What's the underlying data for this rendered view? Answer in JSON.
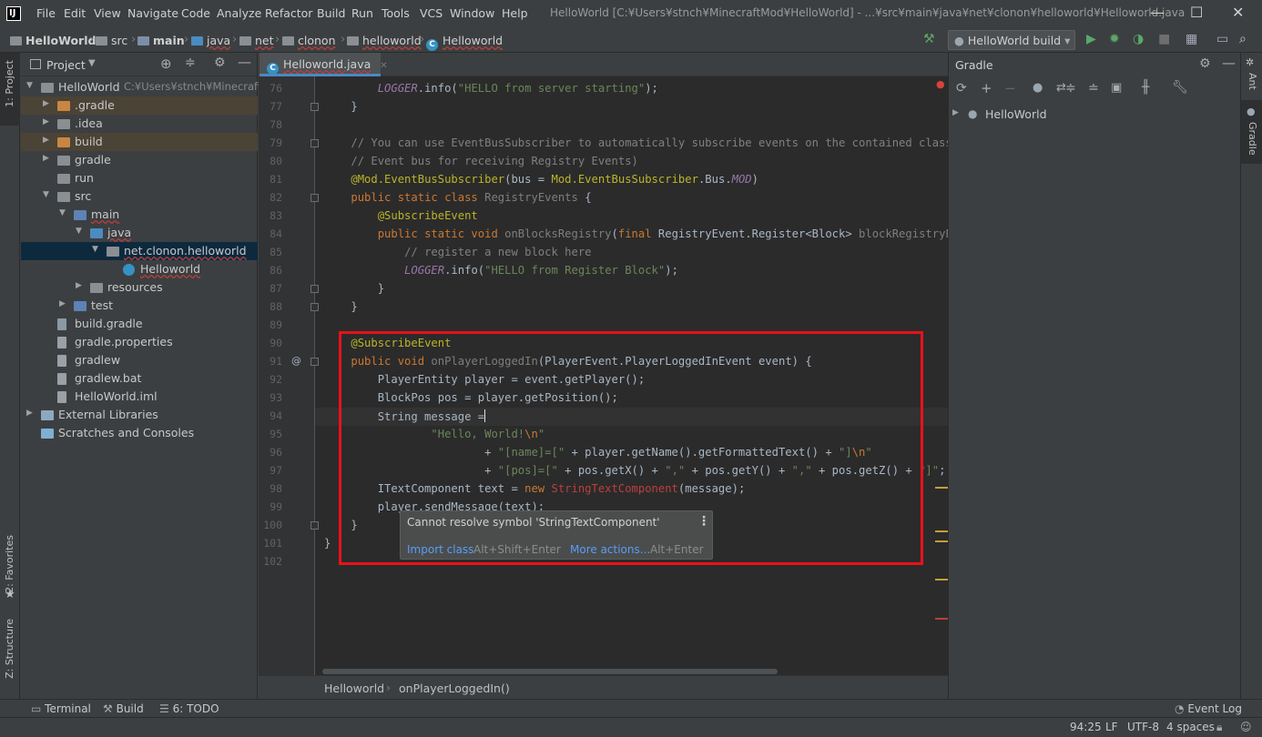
{
  "menu": [
    "File",
    "Edit",
    "View",
    "Navigate",
    "Code",
    "Analyze",
    "Refactor",
    "Build",
    "Run",
    "Tools",
    "VCS",
    "Window",
    "Help"
  ],
  "window_title": "HelloWorld [C:¥Users¥stnch¥MinecraftMod¥HelloWorld] - ...¥src¥main¥java¥net¥clonon¥helloworld¥Helloworld.java",
  "window_controls": {
    "minimize": "—",
    "maximize": "☐",
    "close": "✕"
  },
  "breadcrumbs": [
    "HelloWorld",
    "src",
    "main",
    "java",
    "net",
    "clonon",
    "helloworld",
    "Helloworld"
  ],
  "run_config": "HelloWorld build",
  "project_panel": {
    "title": "Project",
    "tree": [
      {
        "label": "HelloWorld",
        "hint": "C:¥Users¥stnch¥MinecraftMo",
        "depth": 0,
        "arrow": "▼",
        "icon": "folder"
      },
      {
        "label": ".gradle",
        "depth": 1,
        "arrow": "▶",
        "icon": "folder-orange",
        "style": "hl-build"
      },
      {
        "label": ".idea",
        "depth": 1,
        "arrow": "▶",
        "icon": "folder"
      },
      {
        "label": "build",
        "depth": 1,
        "arrow": "▶",
        "icon": "folder-orange",
        "style": "hl-build"
      },
      {
        "label": "gradle",
        "depth": 1,
        "arrow": "▶",
        "icon": "folder"
      },
      {
        "label": "run",
        "depth": 1,
        "arrow": "",
        "icon": "folder"
      },
      {
        "label": "src",
        "depth": 1,
        "arrow": "▼",
        "icon": "folder"
      },
      {
        "label": "main",
        "depth": 2,
        "arrow": "▼",
        "icon": "module"
      },
      {
        "label": "java",
        "depth": 3,
        "arrow": "▼",
        "icon": "folder-blue"
      },
      {
        "label": "net.clonon.helloworld",
        "depth": 4,
        "arrow": "▼",
        "icon": "package",
        "style": "sel"
      },
      {
        "label": "Helloworld",
        "depth": 5,
        "arrow": "",
        "icon": "class"
      },
      {
        "label": "resources",
        "depth": 3,
        "arrow": "▶",
        "icon": "folder-res"
      },
      {
        "label": "test",
        "depth": 2,
        "arrow": "▶",
        "icon": "module"
      },
      {
        "label": "build.gradle",
        "depth": 1,
        "arrow": "",
        "icon": "gradle"
      },
      {
        "label": "gradle.properties",
        "depth": 1,
        "arrow": "",
        "icon": "props"
      },
      {
        "label": "gradlew",
        "depth": 1,
        "arrow": "",
        "icon": "file"
      },
      {
        "label": "gradlew.bat",
        "depth": 1,
        "arrow": "",
        "icon": "file"
      },
      {
        "label": "HelloWorld.iml",
        "depth": 1,
        "arrow": "",
        "icon": "file"
      },
      {
        "label": "External Libraries",
        "depth": 0,
        "arrow": "▶",
        "icon": "libs"
      },
      {
        "label": "Scratches and Consoles",
        "depth": 0,
        "arrow": "",
        "icon": "scratch"
      }
    ]
  },
  "editor": {
    "tab": "Helloworld.java",
    "current_line": 94,
    "lines": [
      {
        "n": 76,
        "html": "        <span class=\"fld\">LOGGER</span>.info(<span class=\"str\">\"HELLO from server starting\"</span>);"
      },
      {
        "n": 77,
        "html": "    }"
      },
      {
        "n": 78,
        "html": ""
      },
      {
        "n": 79,
        "html": "    <span class=\"cmt\">// You can use EventBusSubscriber to automatically subscribe events on the contained class (thi</span>"
      },
      {
        "n": 80,
        "html": "    <span class=\"cmt\">// Event bus for receiving Registry Events)</span>"
      },
      {
        "n": 81,
        "html": "    <span class=\"ann\">@Mod.EventBusSubscriber</span>(bus = <span class=\"ann\">Mod.EventBusSubscriber</span>.Bus.<span class=\"fld\">MOD</span>)"
      },
      {
        "n": 82,
        "html": "    <span class=\"kw\">public static class</span> <span class=\"dim\">RegistryEvents</span> {"
      },
      {
        "n": 83,
        "html": "        <span class=\"ann\">@SubscribeEvent</span>"
      },
      {
        "n": 84,
        "html": "        <span class=\"kw\">public static void</span> <span class=\"dim\">onBlocksRegistry</span>(<span class=\"kw\">final</span> RegistryEvent.Register&lt;Block&gt; <span class=\"dim\">blockRegistryEvent</span>)"
      },
      {
        "n": 85,
        "html": "            <span class=\"cmt\">// register a new block here</span>"
      },
      {
        "n": 86,
        "html": "            <span class=\"fld\">LOGGER</span>.info(<span class=\"str\">\"HELLO from Register Block\"</span>);"
      },
      {
        "n": 87,
        "html": "        }"
      },
      {
        "n": 88,
        "html": "    }"
      },
      {
        "n": 89,
        "html": ""
      },
      {
        "n": 90,
        "html": "    <span class=\"ann\">@SubscribeEvent</span>"
      },
      {
        "n": 91,
        "html": "    <span class=\"kw\">public void</span> <span class=\"dim\">onPlayerLoggedIn</span>(PlayerEvent.PlayerLoggedInEvent event) {"
      },
      {
        "n": 92,
        "html": "        PlayerEntity player = event.getPlayer();"
      },
      {
        "n": 93,
        "html": "        BlockPos pos = player.getPosition();"
      },
      {
        "n": 94,
        "html": "        String message ="
      },
      {
        "n": 95,
        "html": "                <span class=\"str\">\"Hello, World!<span class=\"esc\">\\n</span>\"</span>"
      },
      {
        "n": 96,
        "html": "                        + <span class=\"str\">\"[name]=[\"</span> + player.getName().getFormattedText() + <span class=\"str\">\"]<span class=\"esc\">\\n</span>\"</span>"
      },
      {
        "n": 97,
        "html": "                        + <span class=\"str\">\"[pos]=[\"</span> + pos.getX() + <span class=\"str\">\",\"</span> + pos.getY() + <span class=\"str\">\",\"</span> + pos.getZ() + <span class=\"str\">\"]\"</span>;"
      },
      {
        "n": 98,
        "html": "        ITextComponent text = <span class=\"kw\">new</span> <span class=\"unres\">StringTextComponent</span>(message);"
      },
      {
        "n": 99,
        "html": "        player.sendMessage(text);"
      },
      {
        "n": 100,
        "html": "    }"
      },
      {
        "n": 101,
        "html": "}"
      },
      {
        "n": 102,
        "html": ""
      }
    ],
    "breadcrumb": [
      "Helloworld",
      "onPlayerLoggedIn()"
    ]
  },
  "tooltip": {
    "message": "Cannot resolve symbol 'StringTextComponent'",
    "action1": "Import class",
    "shortcut1": "Alt+Shift+Enter",
    "action2": "More actions...",
    "shortcut2": "Alt+Enter"
  },
  "gradle_panel": {
    "title": "Gradle",
    "root": "HelloWorld"
  },
  "left_tabs": {
    "project": "1: Project",
    "favorites": "2: Favorites",
    "structure": "Z: Structure"
  },
  "right_tabs": {
    "ant": "Ant",
    "gradle": "Gradle"
  },
  "bottom_tools": [
    "Terminal",
    "Build",
    "6: TODO"
  ],
  "event_log": "Event Log",
  "status": {
    "position": "94:25",
    "line_sep": "LF",
    "encoding": "UTF-8",
    "indent": "4 spaces"
  }
}
